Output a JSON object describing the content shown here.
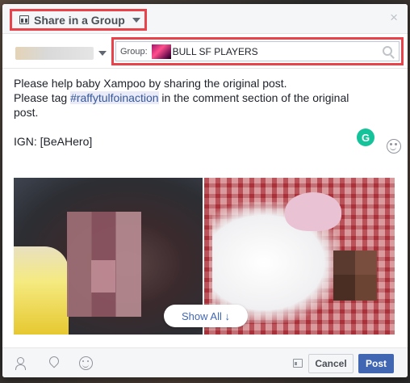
{
  "header": {
    "share_type_label": "Share in a Group",
    "close_label": "×"
  },
  "audience": {
    "group_label": "Group:",
    "group_name": "BULL SF PLAYERS"
  },
  "composer": {
    "line1": "Please help baby Xampoo by sharing the original post.",
    "line2_prefix": "Please tag ",
    "hashtag": "#raffytulfoinaction",
    "line2_suffix": " in the comment section of the original",
    "line3": "post.",
    "line4": "IGN: [BeAHero]"
  },
  "grammarly_letter": "G",
  "attachment": {
    "show_all_label": "Show All ↓"
  },
  "footer": {
    "cancel_label": "Cancel",
    "post_label": "Post"
  },
  "colors": {
    "highlight": "#e8434a",
    "primary": "#4267b2",
    "link": "#365899",
    "grammarly": "#15c39a"
  },
  "icons": [
    "group-icon",
    "chevron-down-icon",
    "close-icon",
    "search-icon",
    "grammarly-icon",
    "emoji-icon",
    "tag-people-icon",
    "location-icon",
    "feeling-icon",
    "privacy-icon"
  ]
}
